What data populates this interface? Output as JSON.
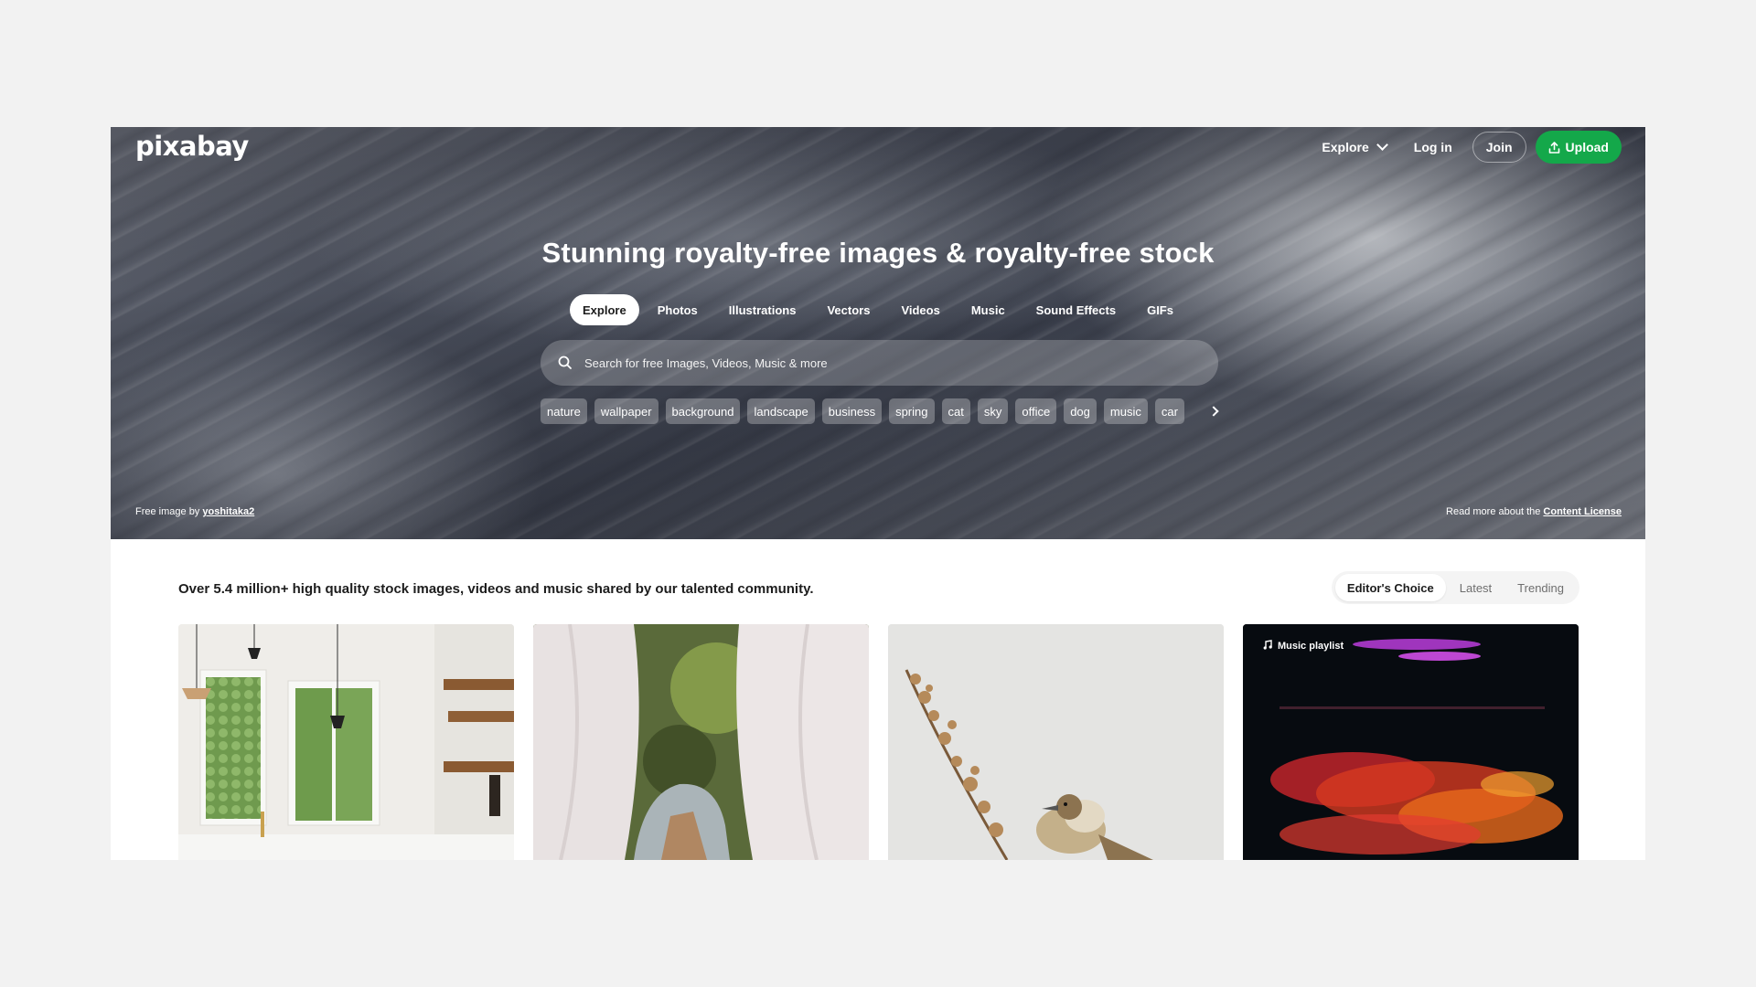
{
  "brand": {
    "logo_text": "pixabay"
  },
  "topnav": {
    "explore_label": "Explore",
    "login_label": "Log in",
    "join_label": "Join",
    "upload_label": "Upload"
  },
  "hero": {
    "headline": "Stunning royalty-free images & royalty-free stock",
    "tabs": [
      {
        "label": "Explore",
        "active": true
      },
      {
        "label": "Photos"
      },
      {
        "label": "Illustrations"
      },
      {
        "label": "Vectors"
      },
      {
        "label": "Videos"
      },
      {
        "label": "Music"
      },
      {
        "label": "Sound Effects"
      },
      {
        "label": "GIFs"
      }
    ],
    "search": {
      "placeholder": "Search for free Images, Videos, Music & more",
      "value": ""
    },
    "tags": [
      "nature",
      "wallpaper",
      "background",
      "landscape",
      "business",
      "spring",
      "cat",
      "sky",
      "office",
      "dog",
      "music",
      "car"
    ],
    "credit_prefix": "Free image by ",
    "credit_user": "yoshitaka2",
    "license_prefix": "Read more about the ",
    "license_link": "Content License"
  },
  "content": {
    "tagline": "Over 5.4 million+ high quality stock images, videos and music shared by our talented community.",
    "sort": [
      {
        "label": "Editor's Choice",
        "active": true
      },
      {
        "label": "Latest"
      },
      {
        "label": "Trending"
      }
    ],
    "music_badge": "Music playlist"
  },
  "colors": {
    "accent_green": "#14a84a",
    "page_bg": "#f2f2f2"
  }
}
